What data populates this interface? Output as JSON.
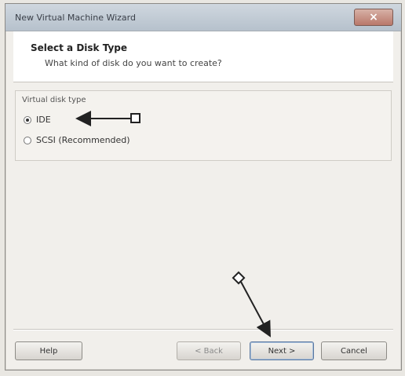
{
  "window": {
    "title": "New Virtual Machine Wizard",
    "close_symbol": "×"
  },
  "header": {
    "title": "Select a Disk Type",
    "subtitle": "What kind of disk do you want to create?"
  },
  "disk_type": {
    "group_label": "Virtual disk type",
    "options": [
      {
        "label": "IDE",
        "selected": true
      },
      {
        "label": "SCSI  (Recommended)",
        "selected": false
      }
    ]
  },
  "buttons": {
    "help": "Help",
    "back": "< Back",
    "next": "Next >",
    "cancel": "Cancel"
  },
  "annotations": {
    "color": "#222222",
    "arrows": [
      "points-to-ide-option",
      "points-to-next-button"
    ]
  }
}
